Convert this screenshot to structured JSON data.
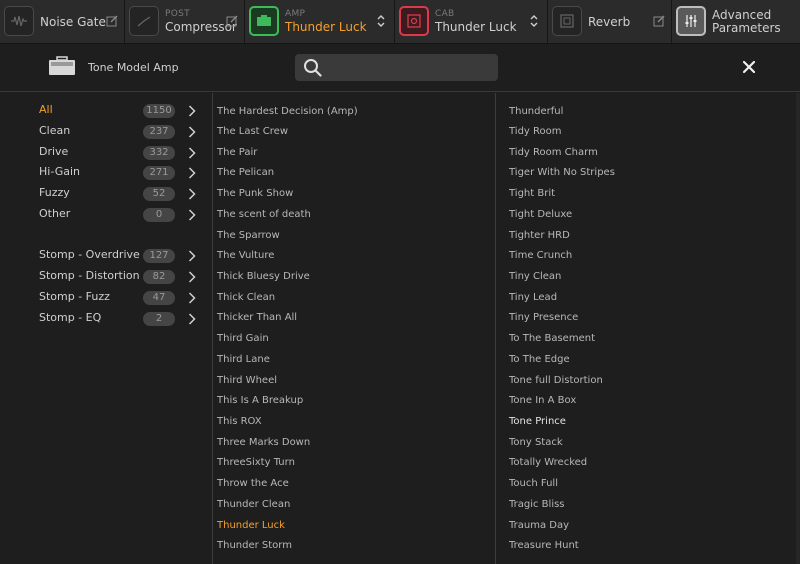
{
  "chain": {
    "noise_gate": {
      "name": "Noise Gate",
      "icon": "noise-gate-icon"
    },
    "compressor": {
      "sub": "POST",
      "name": "Compressor",
      "icon": "compressor-icon"
    },
    "amp": {
      "sub": "AMP",
      "name": "Thunder Luck",
      "icon": "amp-icon"
    },
    "cab": {
      "sub": "CAB",
      "name": "Thunder Luck",
      "icon": "cab-icon"
    },
    "reverb": {
      "name": "Reverb",
      "icon": "reverb-icon"
    },
    "advanced": {
      "name_line1": "Advanced",
      "name_line2": "Parameters",
      "icon": "sliders-icon"
    }
  },
  "header": {
    "title": "Tone Model Amp",
    "search_value": ""
  },
  "categories": [
    {
      "name": "All",
      "count": "1150",
      "active": true
    },
    {
      "name": "Clean",
      "count": "237"
    },
    {
      "name": "Drive",
      "count": "332"
    },
    {
      "name": "Hi-Gain",
      "count": "271"
    },
    {
      "name": "Fuzzy",
      "count": "52"
    },
    {
      "name": "Other",
      "count": "0"
    },
    {
      "name": "Stomp - Overdrive",
      "count": "127"
    },
    {
      "name": "Stomp - Distortion",
      "count": "82"
    },
    {
      "name": "Stomp - Fuzz",
      "count": "47"
    },
    {
      "name": "Stomp - EQ",
      "count": "2"
    }
  ],
  "presets_col1": [
    "The Hardest Decision (Amp)",
    "The Last Crew",
    "The Pair",
    "The Pelican",
    "The Punk Show",
    "The scent of death",
    "The Sparrow",
    "The Vulture",
    "Thick Bluesy Drive",
    "Thick Clean",
    "Thicker Than All",
    "Third Gain",
    "Third Lane",
    "Third Wheel",
    "This Is A Breakup",
    "This ROX",
    "Three Marks Down",
    "ThreeSixty Turn",
    "Throw the Ace",
    "Thunder Clean",
    "Thunder Luck",
    "Thunder Storm"
  ],
  "presets_col2": [
    "Thunderful",
    "Tidy Room",
    "Tidy Room Charm",
    "Tiger With No Stripes",
    "Tight Brit",
    "Tight Deluxe",
    "Tighter HRD",
    "Time Crunch",
    "Tiny Clean",
    "Tiny Lead",
    "Tiny Presence",
    "To The Basement",
    "To The Edge",
    "Tone full Distortion",
    "Tone In A Box",
    "Tone Prince",
    "Tony Stack",
    "Totally Wrecked",
    "Touch Full",
    "Tragic Bliss",
    "Trauma Day",
    "Treasure Hunt"
  ],
  "selected_preset": "Thunder Luck",
  "highlighted_preset": "Tone Prince",
  "colors": {
    "accent": "#f5a02a",
    "amp_border": "#3dbb5a",
    "cab_border": "#d93b4b"
  }
}
